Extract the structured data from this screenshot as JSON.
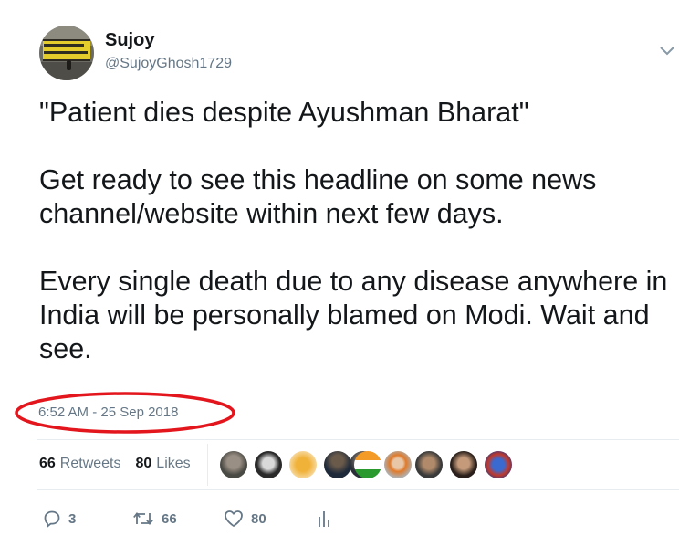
{
  "author": {
    "display_name": "Sujoy",
    "handle": "@SujoyGhosh1729",
    "avatar_icon": "avatar-railway-station-sign"
  },
  "tweet": {
    "text": "\"Patient dies despite Ayushman Bharat\"\n\nGet ready to see this headline on some news channel/website within next few days.\n\nEvery single death due to any disease anywhere in India will be personally blamed on Modi. Wait and see.",
    "timestamp": "6:52 AM - 25 Sep 2018",
    "highlight_color": "#e3161d"
  },
  "stats": {
    "retweets_count": "66",
    "retweets_label": "Retweets",
    "likes_count": "80",
    "likes_label": "Likes"
  },
  "liked_by_icons": [
    "liker-avatar-1",
    "liker-avatar-2",
    "liker-avatar-3",
    "liker-avatar-4",
    "liker-avatar-5",
    "liker-avatar-6",
    "liker-avatar-7",
    "liker-avatar-8",
    "liker-avatar-9",
    "liker-avatar-10"
  ],
  "actions": {
    "reply_count": "3",
    "retweet_count": "66",
    "like_count": "80"
  },
  "colors": {
    "text": "#14171a",
    "secondary": "#657786",
    "divider": "#e6ecf0"
  }
}
